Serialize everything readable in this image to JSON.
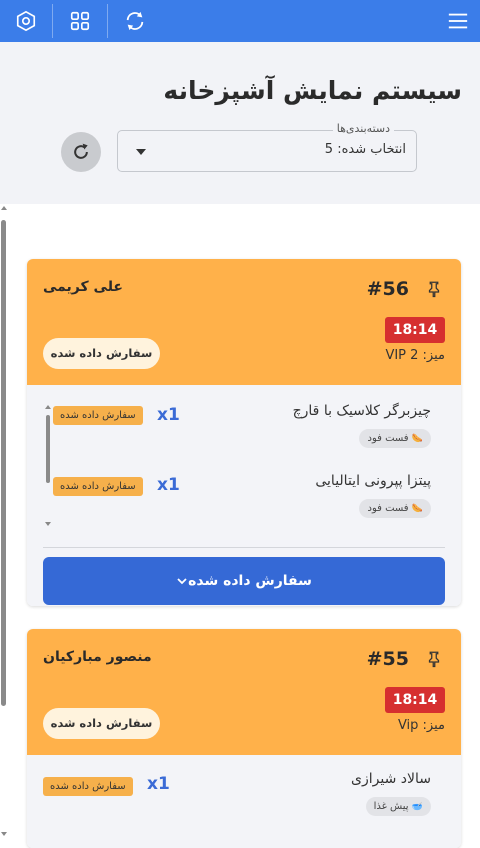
{
  "topbar": {
    "color": "#3b7de9",
    "icons": [
      "settings-hexagon-icon",
      "grid-icon",
      "sync-icon",
      "menu-icon"
    ]
  },
  "header": {
    "title": "سیستم نمایش آشپزخانه",
    "category_select": {
      "legend": "دسته‌بندی‌ها",
      "value": "انتخاب شده: 5"
    }
  },
  "orders": [
    {
      "number": "#56",
      "customer": "علی کریمی",
      "time": "18:14",
      "table": "میز: VIP 2",
      "status": "سفارش داده شده",
      "items": [
        {
          "name": "چیزبرگر کلاسیک با قارچ",
          "category": "فست فود",
          "quantity": "x1",
          "status": "سفارش داده شده"
        },
        {
          "name": "پیتزا پپرونی ایتالیایی",
          "category": "فست فود",
          "quantity": "x1",
          "status": "سفارش داده شده"
        }
      ],
      "action_label": "سفارش داده شده"
    },
    {
      "number": "#55",
      "customer": "منصور مبارکیان",
      "time": "18:14",
      "table": "میز: Vip",
      "status": "سفارش داده شده",
      "items": [
        {
          "name": "سالاد شیرازی",
          "category": "پیش غذا",
          "quantity": "x1",
          "status": "سفارش داده شده"
        }
      ]
    }
  ],
  "colors": {
    "card_header": "#ffb14a",
    "time_badge": "#d62f2f",
    "action_button": "#3569d6",
    "quantity": "#3b6bd6"
  }
}
